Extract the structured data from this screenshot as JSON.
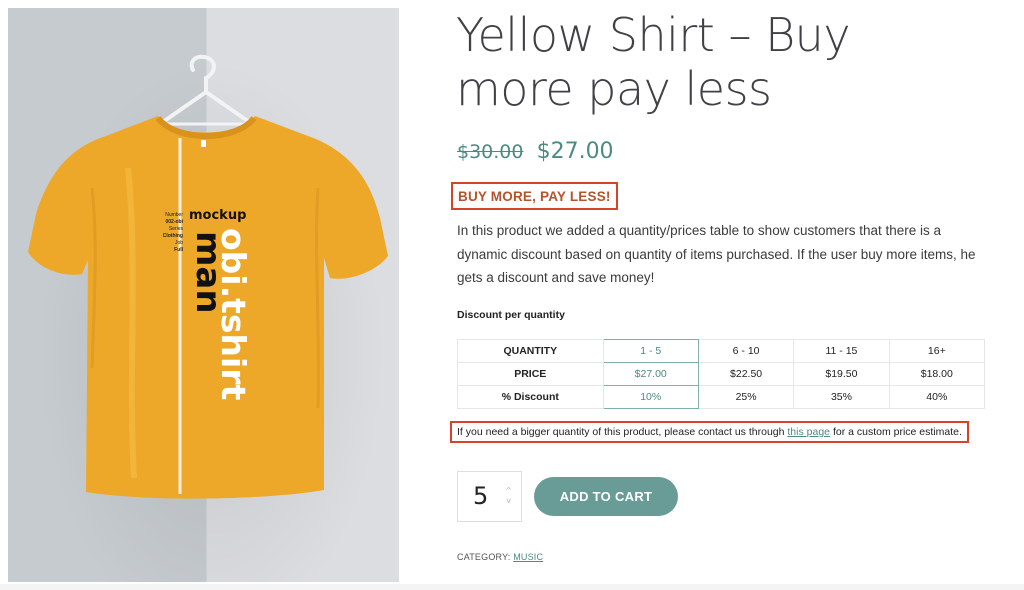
{
  "product": {
    "title_line1": "Yellow Shirt – Buy",
    "title_line2": "more pay less",
    "old_price": "$30.00",
    "new_price": "$27.00",
    "callout": "BUY MORE, PAY LESS!",
    "description": "In this product we added a quantity/prices table to show customers that there is a dynamic discount based on quantity of items purchased. If the user buy more items, he gets a discount and save money!",
    "colors": {
      "accent": "#4d8a84",
      "button": "#699c97",
      "highlight_border": "#d5432b",
      "shirt": "#eea829"
    }
  },
  "image": {
    "shirt_text_small": "mockup",
    "shirt_text_big": "man",
    "shirt_text_vertical": "obi.tshirt",
    "shirt_meta": [
      "Number",
      "002-obi",
      "Series",
      "Clothing",
      "Job",
      "Full"
    ]
  },
  "discount": {
    "title": "Discount per quantity",
    "rows": [
      {
        "label": "QUANTITY",
        "cells": [
          "1 - 5",
          "6 - 10",
          "11 - 15",
          "16+"
        ]
      },
      {
        "label": "PRICE",
        "cells": [
          "$27.00",
          "$22.50",
          "$19.50",
          "$18.00"
        ]
      },
      {
        "label": "% Discount",
        "cells": [
          "10%",
          "25%",
          "35%",
          "40%"
        ]
      }
    ]
  },
  "note": {
    "before": "If you need a bigger quantity of this product, please contact us through",
    "link": "this page",
    "after": "for a custom price estimate."
  },
  "cart": {
    "quantity": "5",
    "spin_up": "^",
    "spin_down": "v",
    "add_label": "ADD TO CART"
  },
  "meta": {
    "category_label": "CATEGORY:",
    "category_value": "MUSIC"
  }
}
